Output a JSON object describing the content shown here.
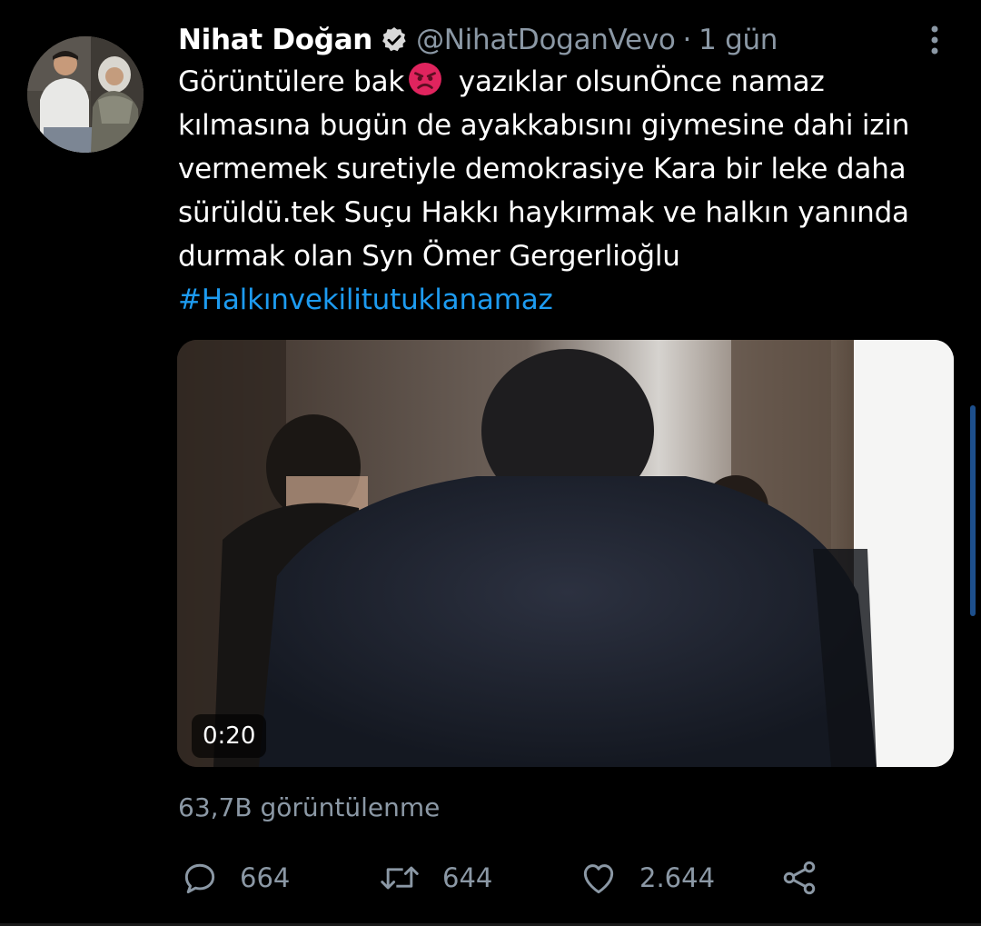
{
  "tweet": {
    "author": {
      "display_name": "Nihat Doğan",
      "handle": "@NihatDoganVevo",
      "verified": true
    },
    "separator": "·",
    "time": "1 gün",
    "text_lines": [
      {
        "before_emoji": "Görüntülere bak",
        "emoji": "angry-face-emoji",
        "after_emoji": " yazıklar olsunÖnce namaz"
      },
      "kılmasına bugün de ayakkabısını giymesine dahi izin",
      "vermemek suretiyle demokrasiye Kara bir leke daha",
      "sürüldü.tek Suçu Hakkı haykırmak ve halkın yanında",
      "durmak olan Syn Ömer Gergerlioğlu"
    ],
    "hashtag": "#Halkınvekilitutuklanamaz",
    "media": {
      "type": "video",
      "duration": "0:20"
    },
    "views": "63,7B görüntülenme",
    "actions": {
      "reply": {
        "icon": "reply-icon",
        "count": "664"
      },
      "retweet": {
        "icon": "retweet-icon",
        "count": "644"
      },
      "like": {
        "icon": "heart-icon",
        "count": "2.644"
      },
      "share": {
        "icon": "share-icon"
      }
    }
  },
  "colors": {
    "background": "#000000",
    "text": "#ffffff",
    "secondary": "#8b98a5",
    "link": "#1d9bf0"
  }
}
